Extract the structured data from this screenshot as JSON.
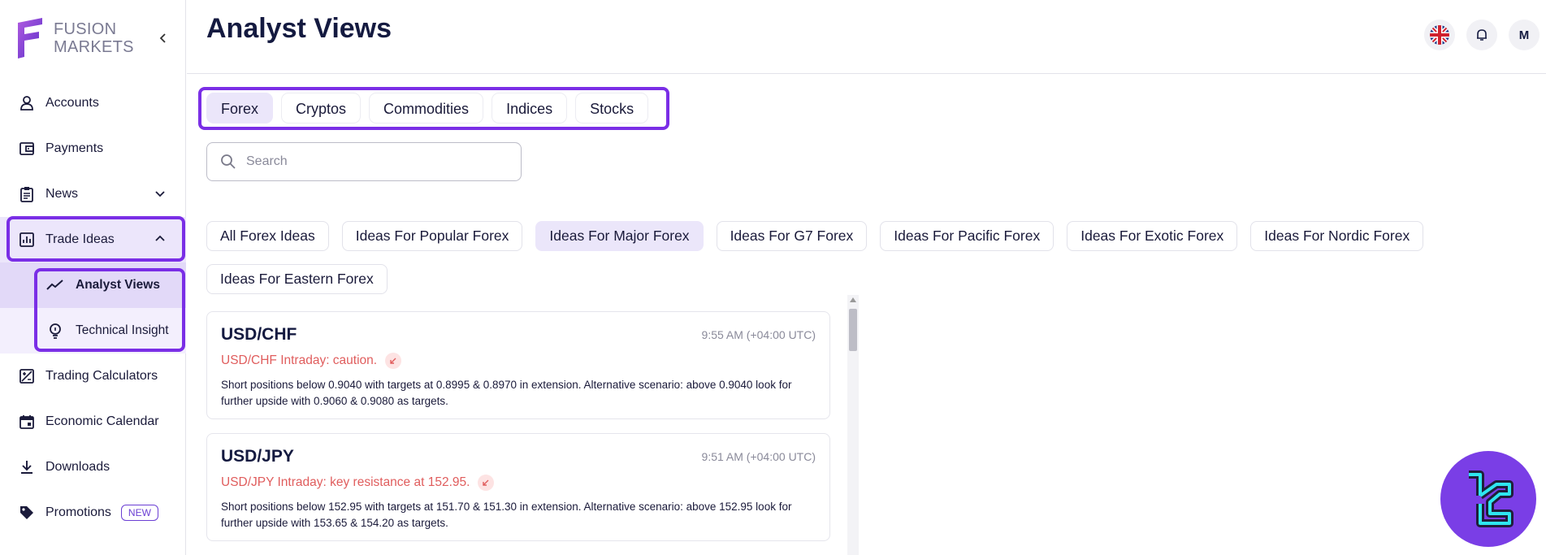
{
  "brand": {
    "line1": "FUSION",
    "line2": "MARKETS"
  },
  "page": {
    "title": "Analyst Views"
  },
  "header": {
    "avatar_initial": "M",
    "flag_icon": "uk-flag-icon",
    "bell_icon": "bell-icon"
  },
  "sidebar": {
    "items": [
      {
        "label": "Accounts",
        "icon": "user-icon"
      },
      {
        "label": "Payments",
        "icon": "wallet-icon"
      },
      {
        "label": "News",
        "icon": "clipboard-icon"
      },
      {
        "label": "Trade Ideas",
        "icon": "bar-chart-icon"
      },
      {
        "label": "Trading Calculators",
        "icon": "calculator-icon"
      },
      {
        "label": "Economic Calendar",
        "icon": "calendar-icon"
      },
      {
        "label": "Downloads",
        "icon": "download-icon"
      },
      {
        "label": "Promotions",
        "icon": "tag-icon",
        "badge": "NEW"
      }
    ],
    "sub_items": [
      {
        "label": "Analyst Views",
        "icon": "trend-icon"
      },
      {
        "label": "Technical Insight",
        "icon": "lightbulb-icon"
      }
    ]
  },
  "tabs": [
    "Forex",
    "Cryptos",
    "Commodities",
    "Indices",
    "Stocks"
  ],
  "search": {
    "placeholder": "Search"
  },
  "chips": [
    "All Forex Ideas",
    "Ideas For Popular Forex",
    "Ideas For Major Forex",
    "Ideas For G7 Forex",
    "Ideas For Pacific Forex",
    "Ideas For Exotic Forex",
    "Ideas For Nordic Forex",
    "Ideas For Eastern Forex"
  ],
  "cards": [
    {
      "pair": "USD/CHF",
      "time": "9:55 AM (+04:00 UTC)",
      "headline": "USD/CHF Intraday: caution.",
      "body": "Short positions below 0.9040 with targets at 0.8995 & 0.8970 in extension. Alternative scenario: above 0.9040 look for further upside with 0.9060 & 0.9080 as targets."
    },
    {
      "pair": "USD/JPY",
      "time": "9:51 AM (+04:00 UTC)",
      "headline": "USD/JPY Intraday: key resistance at 152.95.",
      "body": "Short positions below 152.95 with targets at 151.70 & 151.30 in extension. Alternative scenario: above 152.95 look for further upside with 153.65 & 154.20 as targets."
    }
  ],
  "colors": {
    "accent": "#7a2ee6",
    "bearish": "#e05d5d",
    "active_bg": "#ebe6fa"
  }
}
